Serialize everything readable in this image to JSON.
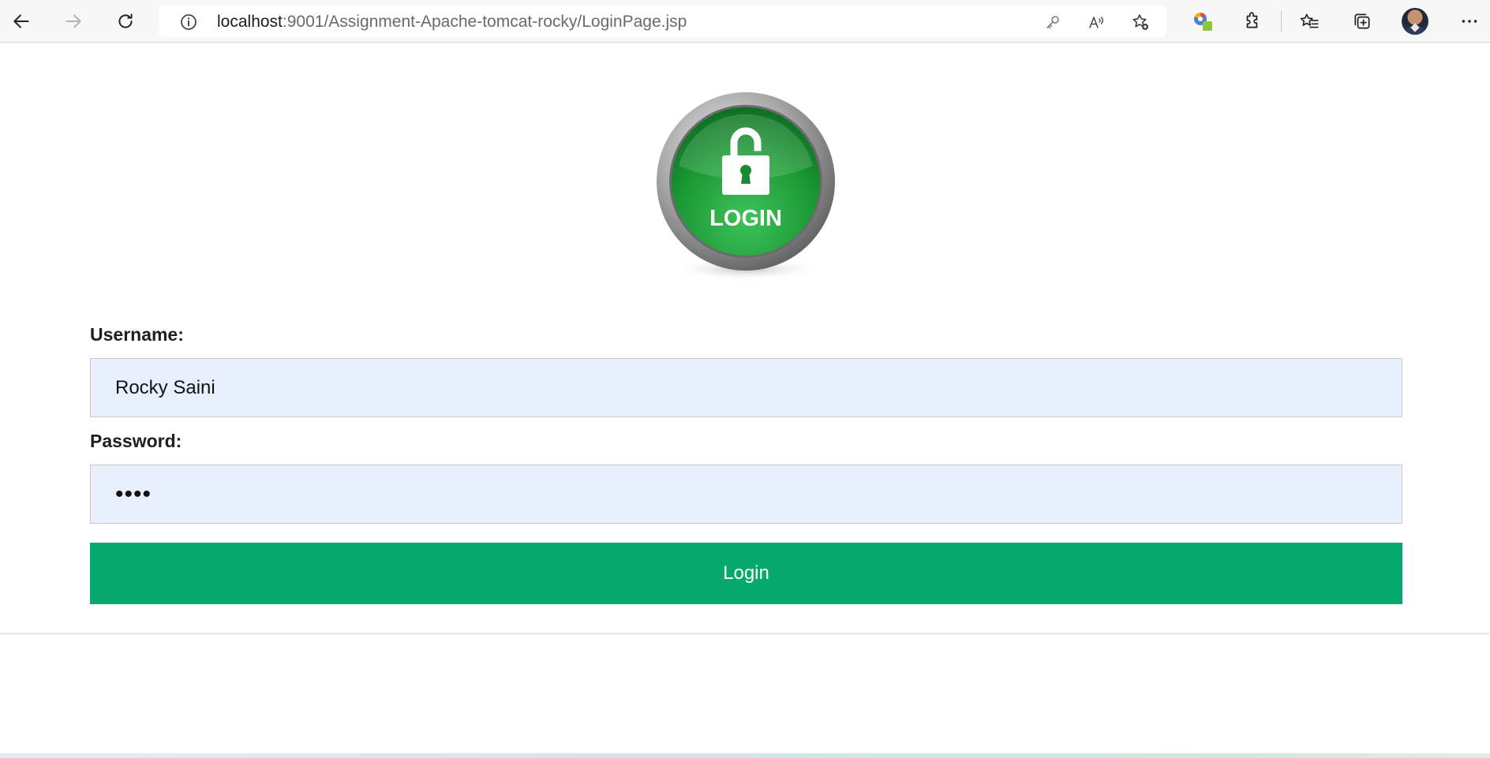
{
  "browser": {
    "url_host": "localhost",
    "url_path": ":9001/Assignment-Apache-tomcat-rocky/LoginPage.jsp",
    "icons": [
      "back-icon",
      "forward-icon",
      "refresh-icon",
      "site-info-icon",
      "password-key-icon",
      "read-aloud-icon",
      "add-favorite-icon",
      "extension-colorful-icon",
      "extensions-icon",
      "favorites-icon",
      "collections-icon",
      "profile-avatar",
      "more-icon"
    ]
  },
  "logo": {
    "text": "LOGIN",
    "colors": {
      "green": "#1f9a3a",
      "ring": "#9a9a9a"
    }
  },
  "form": {
    "username_label": "Username:",
    "username_value": "Rocky Saini",
    "password_label": "Password:",
    "password_value": "••••",
    "login_button": "Login"
  },
  "colors": {
    "button": "#05a86d",
    "field_bg": "#e8f0fe"
  }
}
